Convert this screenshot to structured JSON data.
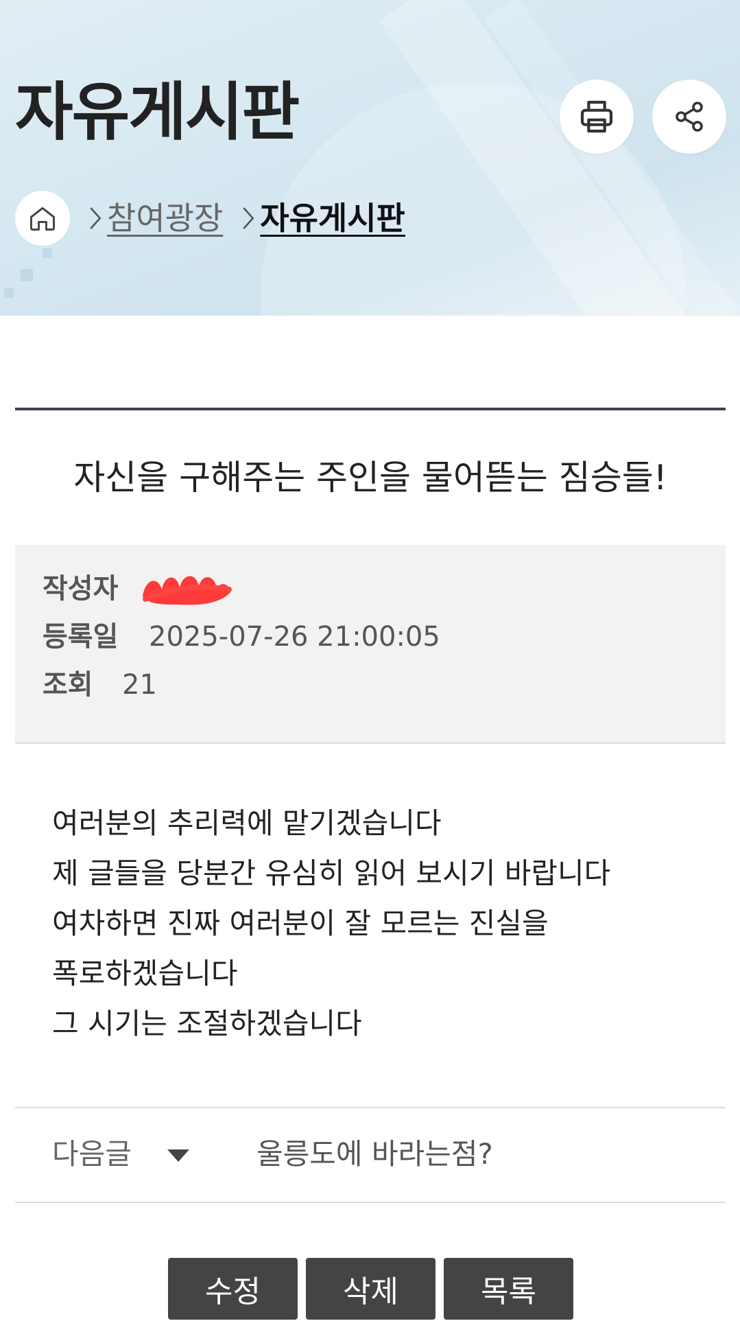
{
  "header": {
    "title": "자유게시판",
    "print_icon": "printer-icon",
    "share_icon": "share-icon"
  },
  "breadcrumb": {
    "home_icon": "home-icon",
    "items": [
      {
        "label": "참여광장"
      },
      {
        "label": "자유게시판"
      }
    ]
  },
  "post": {
    "title": "자신을 구해주는 주인을 물어뜯는 짐승들!",
    "meta": {
      "author_label": "작성자",
      "date_label": "등록일",
      "date_value": "2025-07-26 21:00:05",
      "views_label": "조회",
      "views_value": "21"
    },
    "body_lines": [
      "여러분의 추리력에 맡기겠습니다",
      "제 글들을 당분간 유심히 읽어 보시기 바랍니다",
      "여차하면 진짜 여러분이 잘 모르는 진실을",
      "폭로하겠습니다",
      "그 시기는 조절하겠습니다"
    ]
  },
  "navigation": {
    "next_label": "다음글",
    "next_title": "울릉도에 바라는점?"
  },
  "actions": {
    "edit_label": "수정",
    "delete_label": "삭제",
    "list_label": "목록"
  },
  "colors": {
    "rule": "#3c4250",
    "button_bg": "#444444",
    "redaction": "#ff2a2a"
  }
}
